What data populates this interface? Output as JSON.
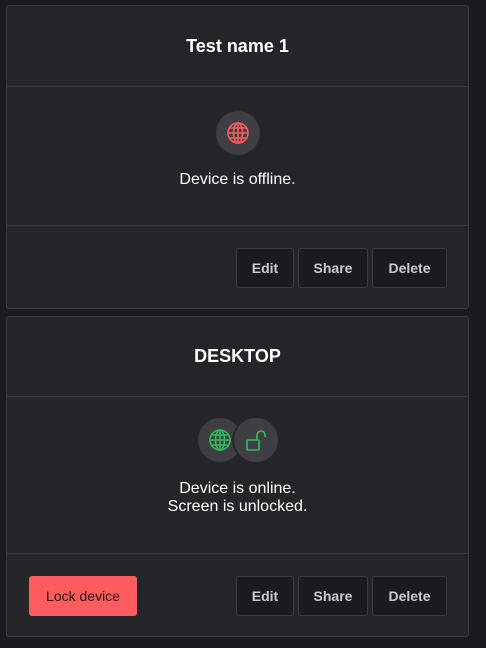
{
  "colors": {
    "offline_icon": "#ff5c5f",
    "online_icon": "#2fbf57",
    "danger_button": "#ff5c5f"
  },
  "devices": [
    {
      "title": "Test name 1",
      "icons": [
        "globe-icon"
      ],
      "status_lines": [
        "Device is offline."
      ],
      "buttons": {
        "edit": "Edit",
        "share": "Share",
        "delete": "Delete"
      }
    },
    {
      "title": "DESKTOP",
      "icons": [
        "globe-icon",
        "unlocked-padlock-icon"
      ],
      "status_lines": [
        "Device is online.",
        "Screen is unlocked."
      ],
      "buttons": {
        "lock": "Lock device",
        "edit": "Edit",
        "share": "Share",
        "delete": "Delete"
      }
    }
  ]
}
